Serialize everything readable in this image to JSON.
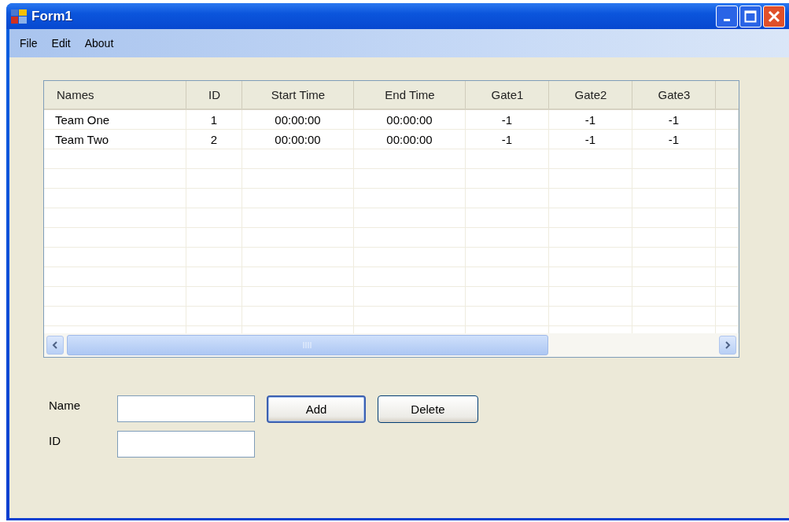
{
  "window": {
    "title": "Form1"
  },
  "menu": [
    {
      "label": "File"
    },
    {
      "label": "Edit"
    },
    {
      "label": "About"
    }
  ],
  "table": {
    "columns": [
      "Names",
      "ID",
      "Start Time",
      "End Time",
      "Gate1",
      "Gate2",
      "Gate3"
    ],
    "rows": [
      [
        "Team One",
        "1",
        "00:00:00",
        "00:00:00",
        "-1",
        "-1",
        "-1"
      ],
      [
        "Team Two",
        "2",
        "00:00:00",
        "00:00:00",
        "-1",
        "-1",
        "-1"
      ]
    ]
  },
  "form": {
    "fields": [
      {
        "label": "Name"
      },
      {
        "label": "ID"
      }
    ],
    "buttons": [
      {
        "label": "Add",
        "default": true
      },
      {
        "label": "Delete",
        "default": false
      }
    ]
  }
}
